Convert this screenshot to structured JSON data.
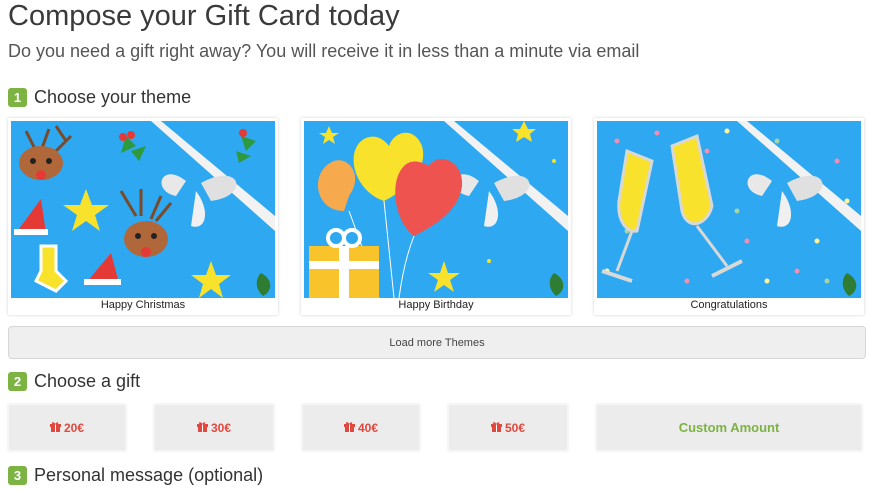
{
  "header": {
    "title": "Compose your Gift Card today",
    "subtitle": "Do you need a gift right away? You will receive it in less than a minute via email"
  },
  "steps": [
    {
      "number": "1",
      "label": "Choose your theme"
    },
    {
      "number": "2",
      "label": "Choose a gift"
    },
    {
      "number": "3",
      "label": "Personal message (optional)"
    }
  ],
  "themes": [
    {
      "caption": "Happy Christmas"
    },
    {
      "caption": "Happy Birthday"
    },
    {
      "caption": "Congratulations"
    }
  ],
  "load_more_label": "Load more Themes",
  "gifts": [
    {
      "label": "20€",
      "icon": "gift-icon"
    },
    {
      "label": "30€",
      "icon": "gift-icon"
    },
    {
      "label": "40€",
      "icon": "gift-icon"
    },
    {
      "label": "50€",
      "icon": "gift-icon"
    }
  ],
  "custom_amount_label": "Custom Amount",
  "colors": {
    "accent_green": "#7cb342",
    "gift_red": "#e0493f",
    "card_blue": "#2ea8f0"
  }
}
